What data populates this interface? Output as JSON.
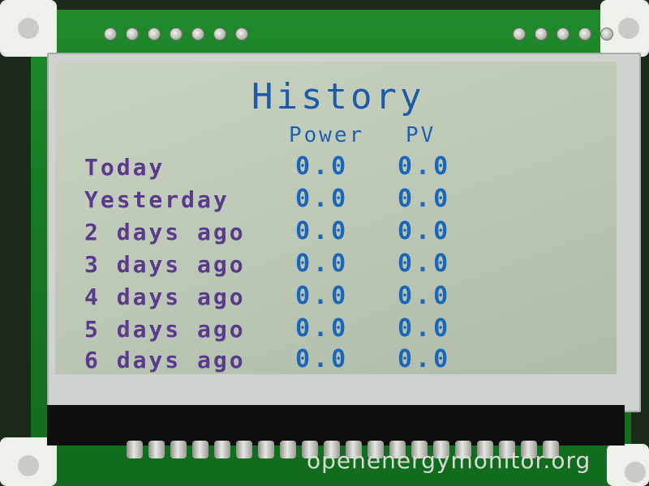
{
  "display": {
    "title": "History",
    "columns": [
      "Power",
      "PV"
    ],
    "rows": [
      {
        "label": "Today",
        "power": "0.0",
        "pv": "0.0"
      },
      {
        "label": "Yesterday",
        "power": "0.0",
        "pv": "0.0"
      },
      {
        "label": "2 days ago",
        "power": "0.0",
        "pv": "0.0"
      },
      {
        "label": "3 days ago",
        "power": "0.0",
        "pv": "0.0"
      },
      {
        "label": "4 days ago",
        "power": "0.0",
        "pv": "0.0"
      },
      {
        "label": "5 days ago",
        "power": "0.0",
        "pv": "0.0"
      },
      {
        "label": "6 days ago",
        "power": "0.0",
        "pv": "0.0"
      }
    ]
  },
  "board": {
    "brand": "openenergymonitor.org"
  },
  "colors": {
    "lcd_text_blue": "#1b66b8",
    "lcd_label_purple": "#5a3a8a",
    "pcb_green": "#177a24",
    "lcd_background": "#b9c6b3"
  }
}
